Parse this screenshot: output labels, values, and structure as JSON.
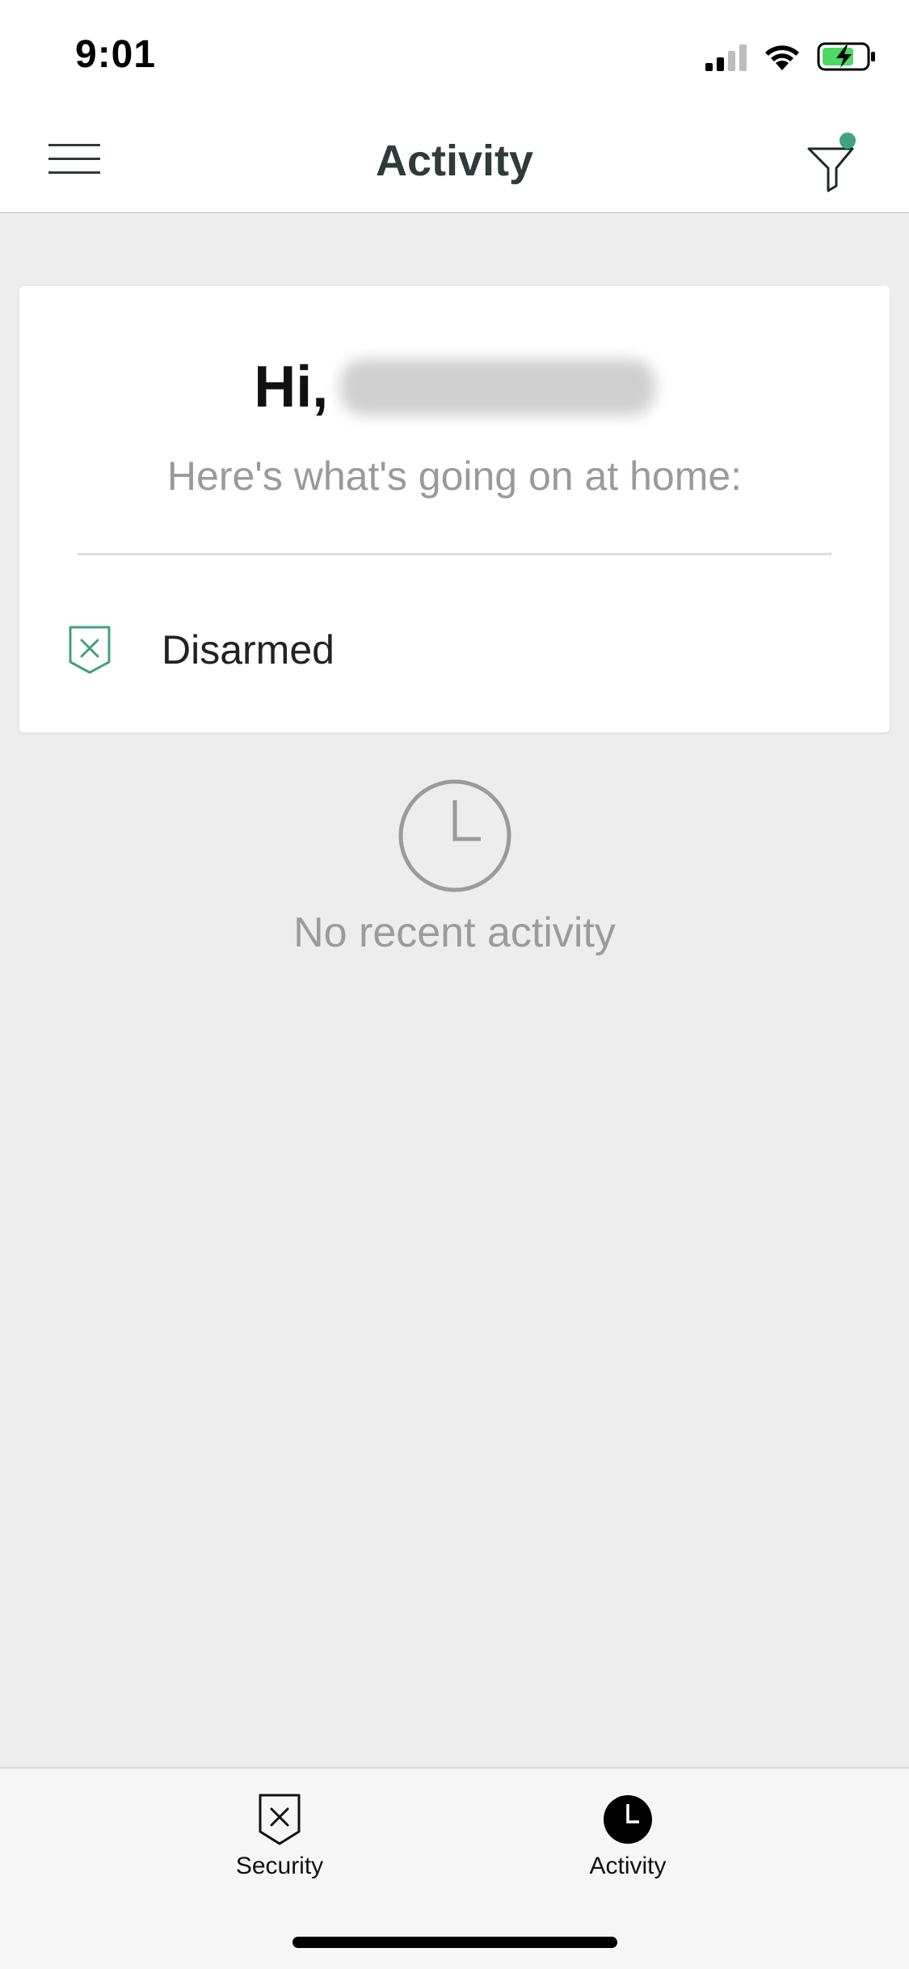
{
  "status_bar": {
    "time": "9:01"
  },
  "header": {
    "title": "Activity",
    "menu_icon": "hamburger-menu-icon",
    "filter_icon": "filter-icon"
  },
  "card": {
    "greeting_prefix": "Hi,",
    "subtitle": "Here's what's going on at home:",
    "status_label": "Disarmed",
    "status_icon": "shield-x-icon"
  },
  "empty_state": {
    "icon": "clock-icon",
    "text": "No recent activity"
  },
  "bottom_nav": {
    "items": [
      {
        "label": "Security",
        "icon": "shield-x-icon",
        "active": false
      },
      {
        "label": "Activity",
        "icon": "clock-icon",
        "active": true
      }
    ]
  },
  "colors": {
    "accent_green": "#3fa37e",
    "header_title": "#2f3b38",
    "muted_text": "#9a9a9a",
    "background": "#ededed"
  }
}
